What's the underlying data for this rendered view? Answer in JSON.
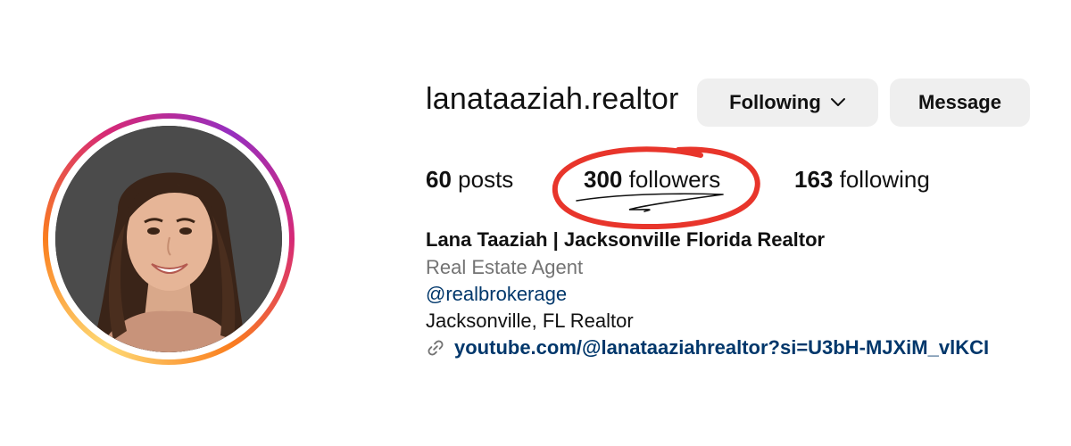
{
  "profile": {
    "username": "lanataaziah.realtor",
    "following_button": "Following",
    "message_button": "Message"
  },
  "stats": {
    "posts_count": "60",
    "posts_label": "posts",
    "followers_count": "300",
    "followers_label": "followers",
    "following_count": "163",
    "following_label": "following"
  },
  "bio": {
    "name": "Lana Taaziah | Jacksonville Florida Realtor",
    "category": "Real Estate Agent",
    "mention": "@realbrokerage",
    "location": "Jacksonville, FL Realtor",
    "link": "youtube.com/@lanataaziahrealtor?si=U3bH-MJXiM_vlKCI"
  },
  "colors": {
    "link_blue": "#00376b",
    "category_gray": "#737373",
    "button_gray": "#efefef",
    "annotation_red": "#e8352b"
  },
  "icons": {
    "dropdown": "chevron-down-icon",
    "link": "link-icon"
  }
}
